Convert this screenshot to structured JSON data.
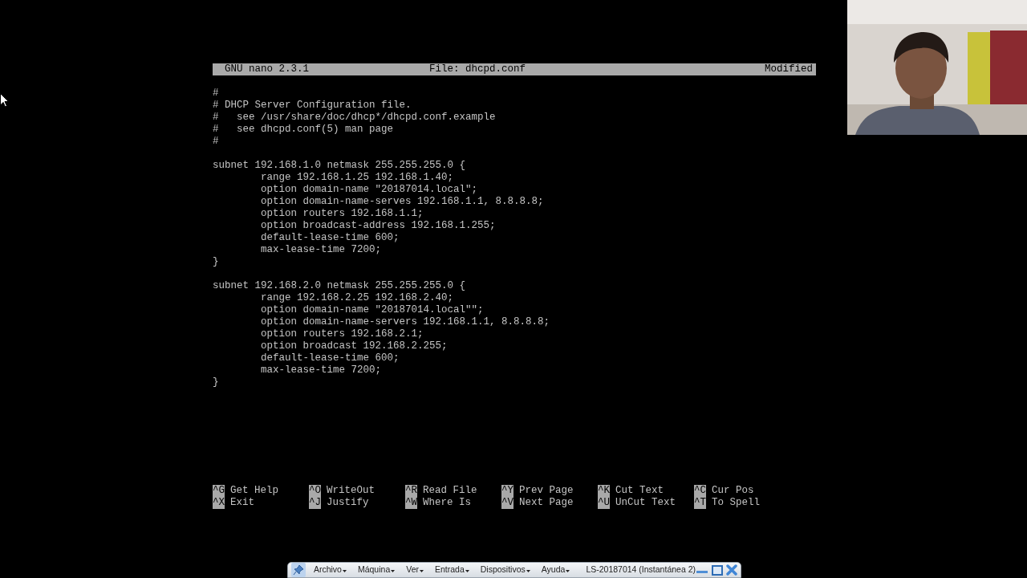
{
  "editor": {
    "title_bar": {
      "version": "GNU nano 2.3.1",
      "file": "File: dhcpd.conf",
      "status": "Modified"
    },
    "blocks": [
      [
        "#",
        "# DHCP Server Configuration file.",
        "#   see /usr/share/doc/dhcp*/dhcpd.conf.example",
        "#   see dhcpd.conf(5) man page",
        "#"
      ],
      [
        "subnet 192.168.1.0 netmask 255.255.255.0 {",
        "        range 192.168.1.25 192.168.1.40;",
        "        option domain-name \"20187014.local\";",
        "        option domain-name-serves 192.168.1.1, 8.8.8.8;",
        "        option routers 192.168.1.1;",
        "        option broadcast-address 192.168.1.255;",
        "        default-lease-time 600;",
        "        max-lease-time 7200;",
        "}"
      ],
      [
        "subnet 192.168.2.0 netmask 255.255.255.0 {",
        "        range 192.168.2.25 192.168.2.40;",
        "        option domain-name \"20187014.local\"\";",
        "        option domain-name-servers 192.168.1.1, 8.8.8.8;",
        "        option routers 192.168.2.1;",
        "        option broadcast 192.168.2.255;",
        "        default-lease-time 600;",
        "        max-lease-time 7200;",
        "}"
      ]
    ],
    "shortcuts": [
      [
        {
          "key": "^G",
          "label": "Get Help"
        },
        {
          "key": "^X",
          "label": "Exit"
        }
      ],
      [
        {
          "key": "^O",
          "label": "WriteOut"
        },
        {
          "key": "^J",
          "label": "Justify"
        }
      ],
      [
        {
          "key": "^R",
          "label": "Read File"
        },
        {
          "key": "^W",
          "label": "Where Is"
        }
      ],
      [
        {
          "key": "^Y",
          "label": "Prev Page"
        },
        {
          "key": "^V",
          "label": "Next Page"
        }
      ],
      [
        {
          "key": "^K",
          "label": "Cut Text"
        },
        {
          "key": "^U",
          "label": "UnCut Text"
        }
      ],
      [
        {
          "key": "^C",
          "label": "Cur Pos"
        },
        {
          "key": "^T",
          "label": "To Spell"
        }
      ]
    ]
  },
  "vm_toolbar": {
    "menus": [
      "Archivo",
      "Máquina",
      "Ver",
      "Entrada",
      "Dispositivos",
      "Ayuda"
    ],
    "title": "LS-20187014 (Instantánea 2)"
  }
}
